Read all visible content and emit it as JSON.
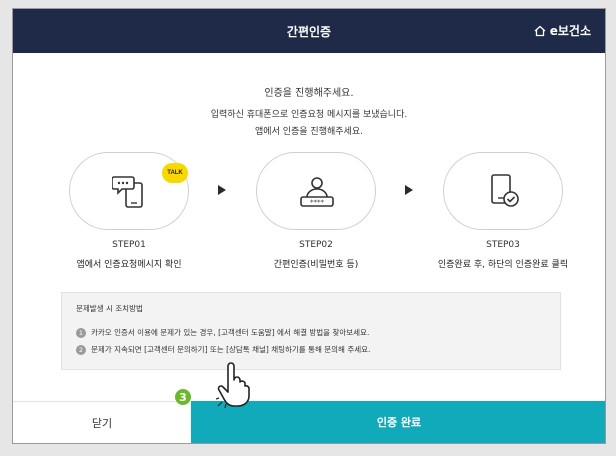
{
  "header": {
    "title": "간편인증",
    "brand": "e보건소"
  },
  "message": {
    "line1": "인증을 진행해주세요.",
    "line2": "입력하신 휴대폰으로 인증요청 메시지를 보냈습니다.",
    "line3": "앱에서 인증을 진행해주세요."
  },
  "steps": [
    {
      "label": "STEP01",
      "desc": "앱에서 인증요청메시지 확인",
      "icon": "phone-message-icon",
      "badge": "TALK"
    },
    {
      "label": "STEP02",
      "desc": "간편인증(비밀번호 등)",
      "icon": "password-user-icon"
    },
    {
      "label": "STEP03",
      "desc": "인증완료 후, 하단의 인증완료 클릭",
      "icon": "phone-check-icon"
    }
  ],
  "notice": {
    "title": "문제발생 시 조치방법",
    "items": [
      {
        "num": "1",
        "text": "카카오 인증서 이용에 문제가 있는 경우, [고객센터 도움말] 에서 해결 방법을 찾아보세요."
      },
      {
        "num": "2",
        "text": "문제가 지속되면 [고객센터 문의하기] 또는 [상담톡 채널] 채팅하기를 통해 문의해 주세요."
      }
    ]
  },
  "footer": {
    "close_label": "닫기",
    "done_label": "인증 완료"
  },
  "annotation": {
    "step_badge": "3"
  },
  "colors": {
    "header": "#1e2a47",
    "done_button": "#11aaba",
    "badge": "#6cb82c",
    "talk": "#f7d800"
  }
}
